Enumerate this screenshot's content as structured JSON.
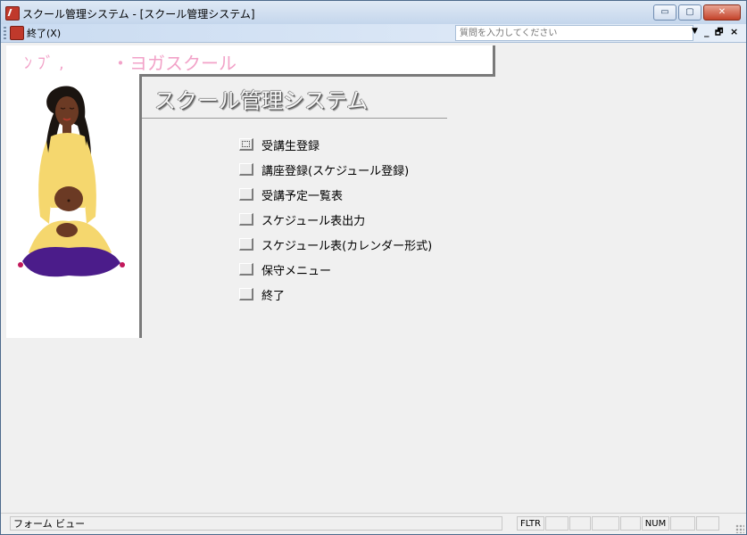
{
  "window": {
    "title": "スクール管理システム - [スクール管理システム]",
    "buttons": {
      "minimize": "▭",
      "maximize": "▢",
      "close": "✕"
    }
  },
  "menubar": {
    "exit_label": "終了(X)",
    "question_placeholder": "質問を入力してください",
    "dropdown_glyph": "▼",
    "mdi_minimize": "_",
    "mdi_restore": "🗗",
    "mdi_close": "×"
  },
  "form": {
    "logo_fragment": "ﾝﾌﾞ,",
    "logo_text": "・ヨガスクール",
    "page_title": "スクール管理システム",
    "image_alt": "yoga-woman",
    "menu_items": [
      {
        "label": "受講生登録",
        "focused": true
      },
      {
        "label": "講座登録(スケジュール登録)"
      },
      {
        "label": "受講予定一覧表"
      },
      {
        "label": "スケジュール表出力"
      },
      {
        "label": "スケジュール表(カレンダー形式)"
      },
      {
        "label": "保守メニュー"
      },
      {
        "label": "終了"
      }
    ]
  },
  "statusbar": {
    "view_text": "フォーム ビュー",
    "filter": "FLTR",
    "num": "NUM"
  },
  "colors": {
    "logo_pink": "#f2a2c8",
    "titlebar_top": "#dfe9f5",
    "titlebar_bottom": "#c4d6ec",
    "skin": "#6b3a24",
    "outfit_yellow": "#f5d76e",
    "cushion_purple": "#4b1c8a"
  }
}
